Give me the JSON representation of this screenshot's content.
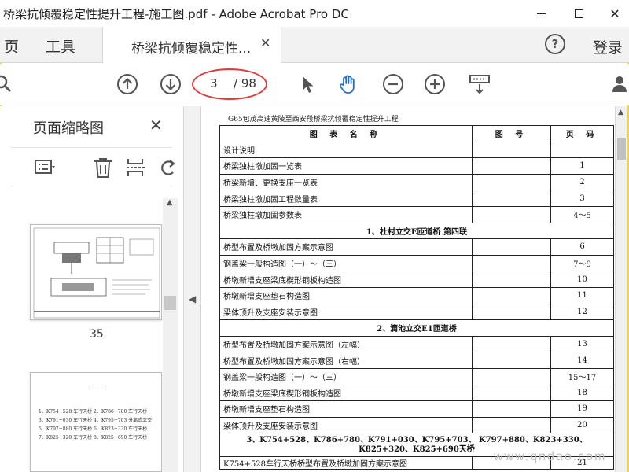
{
  "window": {
    "title": "桥梁抗倾覆稳定性提升工程-施工图.pdf - Adobe Acrobat Pro DC"
  },
  "nav": {
    "page_tab": "页",
    "tools_tab": "工具",
    "doc_tab_label": "桥梁抗倾覆稳定性...",
    "help": "?",
    "login": "登录"
  },
  "toolbar": {
    "current_page": "3",
    "total_pages": "/ 98",
    "icons": [
      "search-icon",
      "page-up-icon",
      "page-down-icon",
      "select-cursor-icon",
      "hand-tool-icon",
      "zoom-out-icon",
      "zoom-in-icon",
      "scroll-mode-icon",
      "user-share-icon"
    ]
  },
  "thumbnails": {
    "header": "页面缩略图",
    "close": "✕",
    "items": [
      {
        "label": "35"
      },
      {
        "label": "",
        "lines": [
          "1、K754+528 车行天桥 2、K786+780 车行天桥",
          "3、K791+030 车行天桥 4、K795+703 分离式立交",
          "5、K797+880 车行天桥 6、K823+330 车行天桥",
          "7、K825+320 车行天桥 8、K825+690 车行天桥"
        ]
      }
    ]
  },
  "document": {
    "header": "G65包茂高速黄陵至西安段桥梁抗倾覆稳定性提升工程",
    "columns": [
      "图 表 名 称",
      "图 号",
      "页 码"
    ],
    "rows": [
      {
        "type": "row",
        "name": "设计说明",
        "code": "",
        "page": ""
      },
      {
        "type": "row",
        "name": "桥梁独柱墩加固一览表",
        "code": "",
        "page": "1"
      },
      {
        "type": "row",
        "name": "桥梁新增、更换支座一览表",
        "code": "",
        "page": "2"
      },
      {
        "type": "row",
        "name": "桥梁独柱墩加固工程数量表",
        "code": "",
        "page": "3"
      },
      {
        "type": "row",
        "name": "桥梁独柱墩加固参数表",
        "code": "",
        "page": "4～5"
      },
      {
        "type": "section",
        "name": "1、杜村立交E匝道桥 第四联"
      },
      {
        "type": "row",
        "name": "桥型布置及桥墩加固方案示意图",
        "code": "",
        "page": "6"
      },
      {
        "type": "row",
        "name": "钢盖梁一般构造图（一）～（三）",
        "code": "",
        "page": "7～9"
      },
      {
        "type": "row",
        "name": "桥墩新增支座梁底楔形钢板构造图",
        "code": "",
        "page": "10"
      },
      {
        "type": "row",
        "name": "桥墩新增支座垫石构造图",
        "code": "",
        "page": "11"
      },
      {
        "type": "row",
        "name": "梁体顶升及支座安装示意图",
        "code": "",
        "page": "12"
      },
      {
        "type": "section",
        "name": "2、滴池立交E1匝道桥"
      },
      {
        "type": "row",
        "name": "桥型布置及桥墩加固方案示意图（左幅）",
        "code": "",
        "page": "13"
      },
      {
        "type": "row",
        "name": "桥型布置及桥墩加固方案示意图（右幅）",
        "code": "",
        "page": "14"
      },
      {
        "type": "row",
        "name": "钢盖梁一般构造图（一）～（三）",
        "code": "",
        "page": "15～17"
      },
      {
        "type": "row",
        "name": "桥墩新增支座梁底楔形钢板构造图",
        "code": "",
        "page": "18"
      },
      {
        "type": "row",
        "name": "桥墩新增支座垫石构造图",
        "code": "",
        "page": "19"
      },
      {
        "type": "row",
        "name": "梁体顶升及支座安装示意图",
        "code": "",
        "page": "20"
      },
      {
        "type": "section",
        "name": "3、K754+528、K786+780、K791+030、K795+703、 K797+880、K823+330、K825+320、K825+690天桥"
      },
      {
        "type": "row",
        "name": "K754+528车行天桥桥型布置及桥墩加固方案示意图",
        "code": "",
        "page": "21"
      }
    ]
  },
  "watermark": "www.qndao.com",
  "colors": {
    "frame_border": "#f7d23a",
    "annotation_oval": "#e23a3a",
    "toolbar_icon": "#555555",
    "hand_tool_active": "#1f6fd1"
  }
}
